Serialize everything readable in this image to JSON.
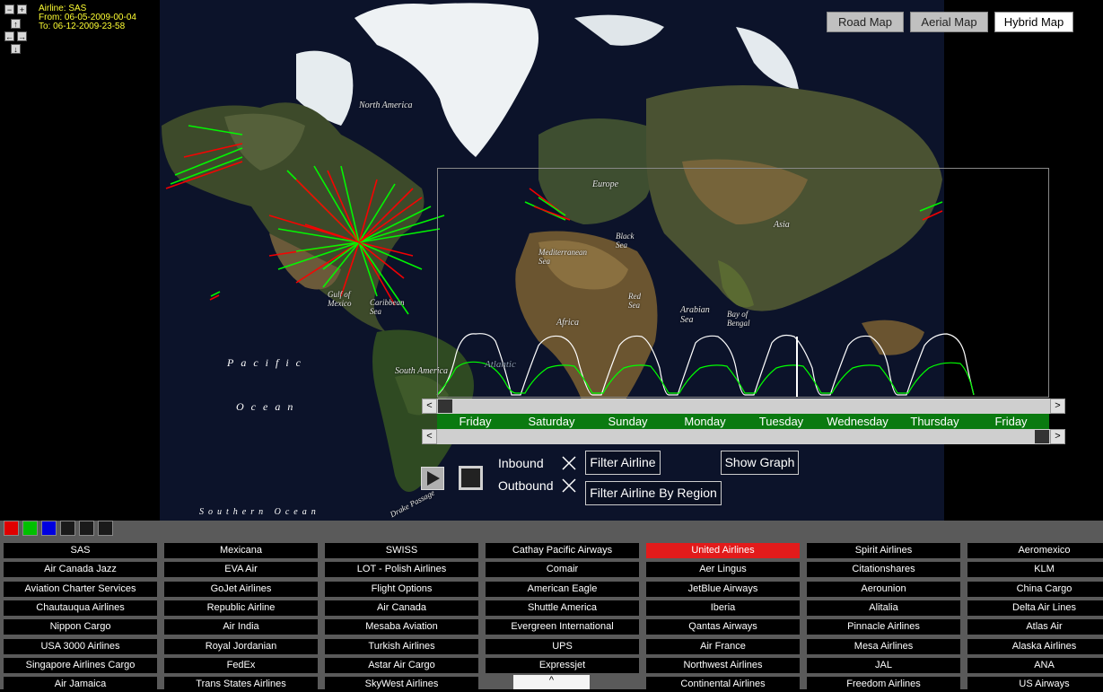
{
  "info": {
    "airline": "Airline: SAS",
    "from": "From: 06-05-2009-00-04",
    "to": "To: 06-12-2009-23-58"
  },
  "nav_controls": {
    "zoom_out": "−",
    "zoom_in": "+",
    "up": "↑",
    "left": "←",
    "right": "→",
    "down": "↓"
  },
  "map_types": [
    "Road Map",
    "Aerial Map",
    "Hybrid Map"
  ],
  "map_types_active": "Hybrid Map",
  "map_labels": {
    "north_america": "North America",
    "europe": "Europe",
    "asia": "Asia",
    "africa": "Africa",
    "south_america": "South America",
    "gulf_of_mexico": "Gulf of Mexico",
    "caribbean_sea": "Caribbean Sea",
    "black_sea": "Black Sea",
    "mediterranean_sea": "Mediterranean Sea",
    "red_sea": "Red Sea",
    "arabian_sea": "Arabian Sea",
    "bay_of_bengal": "Bay of Bengal",
    "atlantic": "Atlantic",
    "drake_passage": "Drake Passage"
  },
  "oceans": {
    "pacific": "Pacific",
    "ocean": "Ocean",
    "southern_ocean": "Southern Ocean"
  },
  "timeline": {
    "days": [
      "Friday",
      "Saturday",
      "Sunday",
      "Monday",
      "Tuesday",
      "Wednesday",
      "Thursday",
      "Friday"
    ],
    "left_arrow": "<",
    "right_arrow": ">"
  },
  "controls": {
    "inbound": "Inbound",
    "outbound": "Outbound",
    "filter_airline": "Filter Airline",
    "filter_by_region": "Filter Airline By Region",
    "show_graph": "Show Graph"
  },
  "colors": {
    "inbound": "#00ff00",
    "outbound": "#ff0000",
    "selected_airline": "#e21b1b",
    "timeline_bar": "#0a7a10",
    "info_text": "#ffff33"
  },
  "color_swatches": [
    "#e00000",
    "#00c000",
    "#0000e0",
    "#1a1a1a",
    "#1a1a1a",
    "#1a1a1a"
  ],
  "airlines": [
    [
      "SAS",
      "Mexicana",
      "SWISS",
      "Cathay Pacific Airways",
      "United Airlines",
      "Spirit Airlines",
      "Aeromexico"
    ],
    [
      "Air Canada Jazz",
      "EVA Air",
      "LOT - Polish Airlines",
      "Comair",
      "Aer Lingus",
      "Citationshares",
      "KLM"
    ],
    [
      "Aviation Charter Services",
      "GoJet Airlines",
      "Flight Options",
      "American Eagle",
      "JetBlue Airways",
      "Aerounion",
      "China Cargo"
    ],
    [
      "Chautauqua Airlines",
      "Republic Airline",
      "Air Canada",
      "Shuttle America",
      "Iberia",
      "Alitalia",
      "Delta Air Lines"
    ],
    [
      "Nippon Cargo",
      "Air India",
      "Mesaba Aviation",
      "Evergreen International",
      "Qantas Airways",
      "Pinnacle Airlines",
      "Atlas Air"
    ],
    [
      "USA 3000 Airlines",
      "Royal Jordanian",
      "Turkish Airlines",
      "UPS",
      "Air France",
      "Mesa Airlines",
      "Alaska Airlines"
    ],
    [
      "Singapore Airlines Cargo",
      "FedEx",
      "Astar Air Cargo",
      "Expressjet",
      "Northwest Airlines",
      "JAL",
      "ANA"
    ],
    [
      "Air Jamaica",
      "Trans States Airlines",
      "SkyWest Airlines",
      "",
      "Continental Airlines",
      "Freedom Airlines",
      "US Airways"
    ]
  ],
  "selected_airline": "United Airlines",
  "collapse_tab": "^"
}
